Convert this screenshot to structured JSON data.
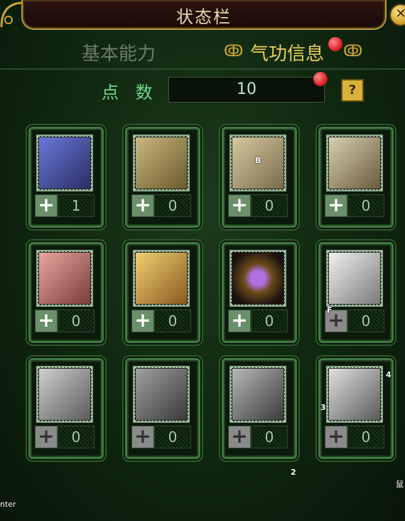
{
  "window": {
    "title": "状态栏"
  },
  "tabs": {
    "basic": "基本能力",
    "qigong": "气功信息"
  },
  "points": {
    "label": "点 数",
    "value": "10",
    "help": "?"
  },
  "skills": [
    {
      "level": "1",
      "icon": "blade-icon",
      "locked": false
    },
    {
      "level": "0",
      "icon": "scroll-icon",
      "locked": false
    },
    {
      "level": "0",
      "icon": "sword-hilt-icon",
      "locked": false
    },
    {
      "level": "0",
      "icon": "boulder-icon",
      "locked": false
    },
    {
      "level": "0",
      "icon": "warrior-portrait-icon",
      "locked": false
    },
    {
      "level": "0",
      "icon": "monk-portrait-icon",
      "locked": false
    },
    {
      "level": "0",
      "icon": "purple-orb-icon",
      "locked": false
    },
    {
      "level": "0",
      "icon": "feather-blade-icon",
      "locked": true
    },
    {
      "level": "0",
      "icon": "dragon-icon",
      "locked": true
    },
    {
      "level": "0",
      "icon": "armor-icon",
      "locked": true
    },
    {
      "level": "0",
      "icon": "beast-fight-icon",
      "locked": true
    },
    {
      "level": "0",
      "icon": "tiger-icon",
      "locked": true
    }
  ],
  "markers": {
    "b": "B",
    "f": "F",
    "m2": "2",
    "m3": "3",
    "m4": "4",
    "edge_left": "nter",
    "edge_right": "鼠"
  },
  "colors": {
    "gold": "#e8cf56",
    "green": "#6fd78a",
    "red_dot": "#e0242a"
  }
}
